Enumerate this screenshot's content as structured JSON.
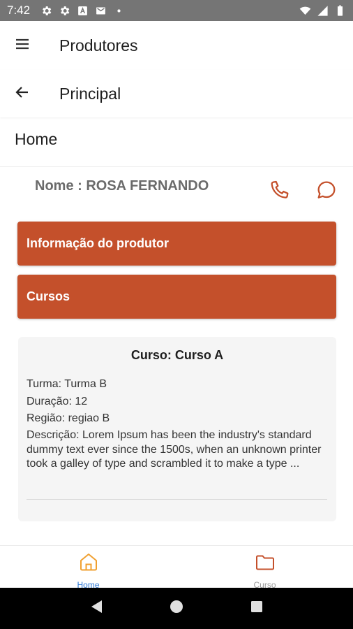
{
  "status_bar": {
    "time": "7:42"
  },
  "appbar": {
    "title": "Produtores",
    "menu_icon": "hamburger-menu-icon"
  },
  "subbar": {
    "title": "Principal",
    "back_icon": "arrow-back-icon"
  },
  "home_heading": "Home",
  "producer": {
    "name_label": "Nome : ROSA FERNANDO"
  },
  "buttons": {
    "info": "Informação do produtor",
    "cursos": "Cursos"
  },
  "course_card": {
    "title": "Curso: Curso A",
    "turma": "Turma: Turma B",
    "duracao": "Duração: 12",
    "regiao": "Região: regiao B",
    "descricao": "Descrição: Lorem Ipsum has been the industry's standard dummy text ever since the 1500s, when an unknown printer took a galley of type and scrambled it to make a type ..."
  },
  "bottom_nav": {
    "home_label": "Home",
    "curso_label": "Curso"
  },
  "colors": {
    "accent": "#c4502b",
    "nav_active": "#2f7ad6",
    "home_icon": "#f0a030"
  }
}
